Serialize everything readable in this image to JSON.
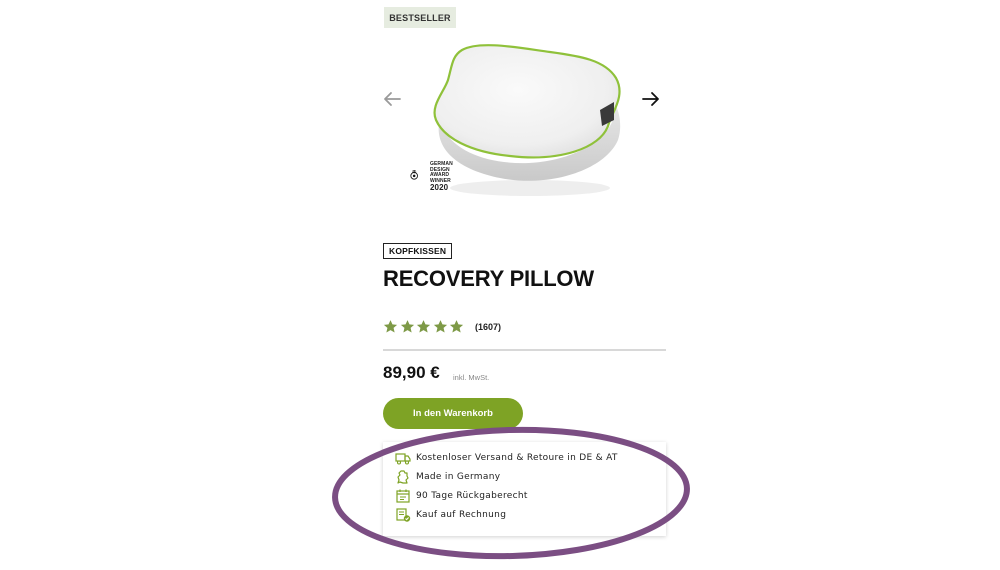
{
  "badge": {
    "label": "BESTSELLER"
  },
  "gallery": {
    "prev_icon": "arrow-left-icon",
    "next_icon": "arrow-right-icon",
    "award": {
      "lines": [
        "GERMAN",
        "DESIGN",
        "AWARD",
        "WINNER"
      ],
      "year": "2020"
    }
  },
  "product": {
    "category": "KOPFKISSEN",
    "title": "RECOVERY PILLOW",
    "rating": {
      "stars": 5,
      "max_stars": 5,
      "count": "(1607)"
    },
    "price": "89,90 €",
    "tax_note": "inkl. MwSt."
  },
  "cart": {
    "button_label": "In den Warenkorb"
  },
  "usps": [
    {
      "icon": "truck-icon",
      "label": "Kostenloser Versand & Retoure in DE & AT"
    },
    {
      "icon": "germany-map-icon",
      "label": "Made in Germany"
    },
    {
      "icon": "calendar-icon",
      "label": "90 Tage Rückgaberecht"
    },
    {
      "icon": "invoice-check-icon",
      "label": "Kauf auf Rechnung"
    }
  ],
  "colors": {
    "accent_green": "#7ea325",
    "star_green": "#7e9a47",
    "badge_bg": "#e6ece0",
    "annotation_purple": "#7b4e83"
  }
}
